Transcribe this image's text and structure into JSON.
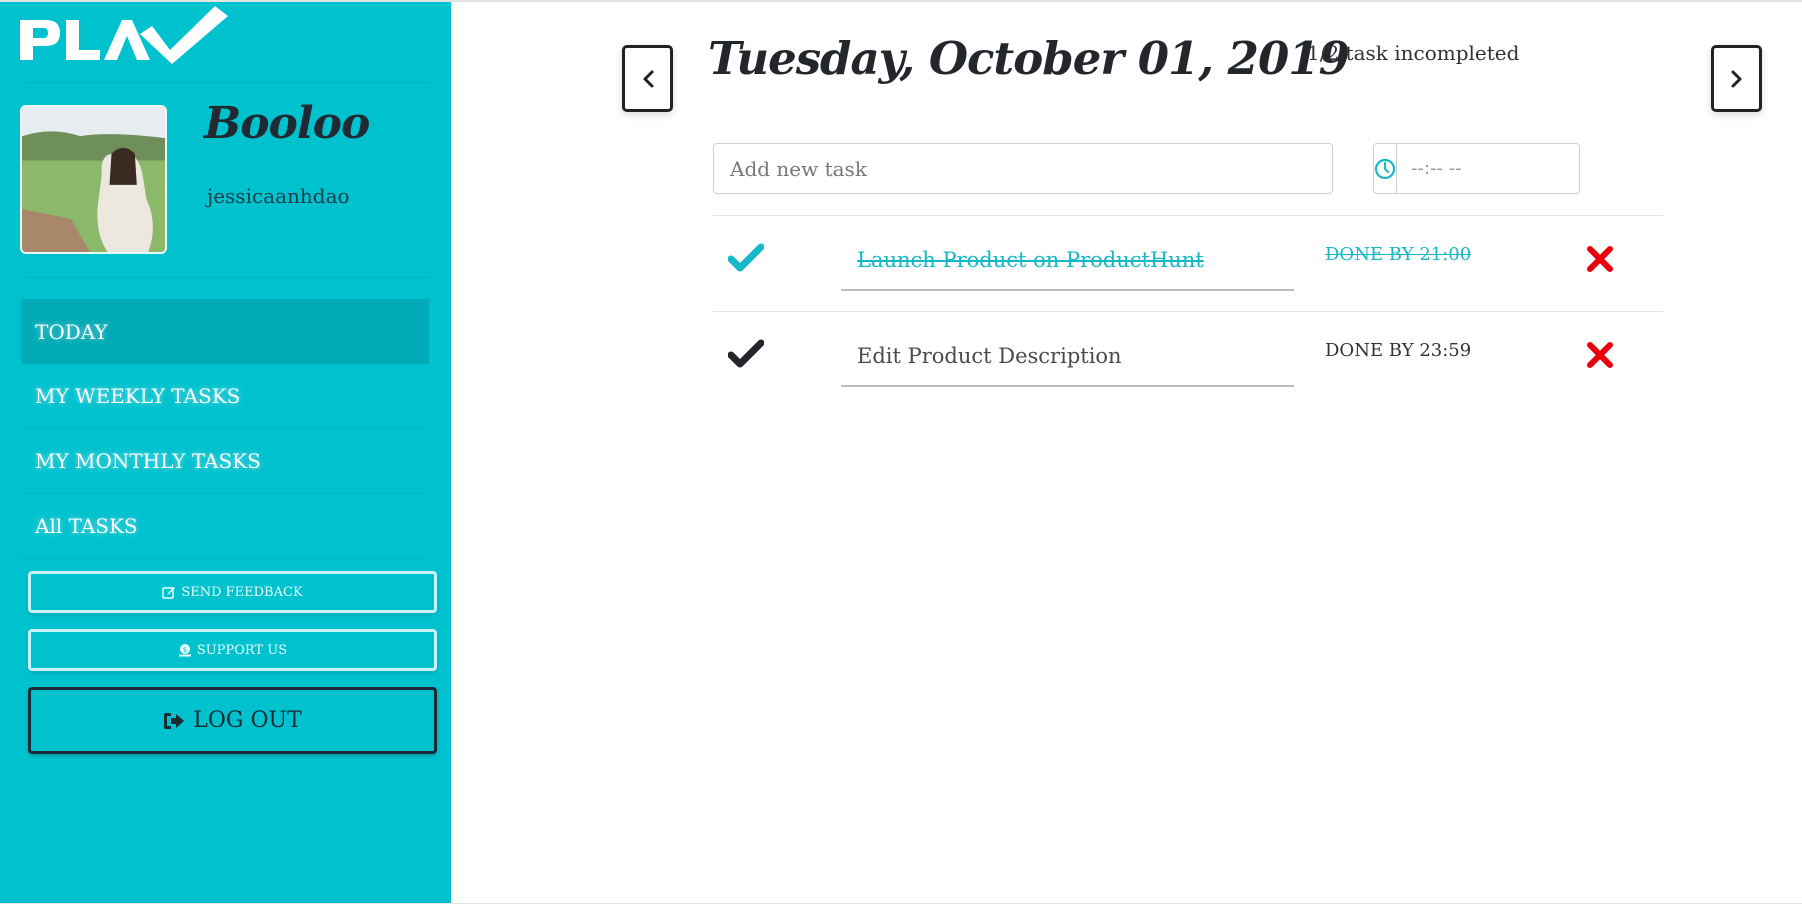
{
  "app": {
    "logo_text": "PLAN",
    "brand_color": "#00c2cf",
    "accent_dark": "#00aab6",
    "danger_color": "#e8000b"
  },
  "profile": {
    "display_name": "Booloo",
    "username": "jessicaanhdao",
    "avatar_alt": "profile photo"
  },
  "sidebar": {
    "nav": [
      {
        "label": "TODAY",
        "active": true
      },
      {
        "label": "MY WEEKLY TASKS",
        "active": false
      },
      {
        "label": "MY MONTHLY TASKS",
        "active": false
      },
      {
        "label": "All TASKS",
        "active": false
      }
    ],
    "send_feedback": {
      "label": "SEND FEEDBACK",
      "icon": "edit-icon"
    },
    "support_us": {
      "label": "SUPPORT US",
      "icon": "donate-icon"
    },
    "log_out": {
      "label": "LOG OUT",
      "icon": "sign-out-icon"
    }
  },
  "main": {
    "date_title": "Tuesday, October 01, 2019",
    "counter": "1/2 task incompleted",
    "prev_icon": "chevron-left-icon",
    "next_icon": "chevron-right-icon",
    "new_task": {
      "placeholder": "Add new task",
      "value": ""
    },
    "time": {
      "placeholder": "--:-- --",
      "value": "",
      "icon": "clock-icon"
    },
    "tasks": [
      {
        "title": "Launch Product on ProductHunt",
        "deadline": "DONE BY 21:00",
        "completed": true
      },
      {
        "title": "Edit Product Description",
        "deadline": "DONE BY 23:59",
        "completed": false
      }
    ]
  }
}
